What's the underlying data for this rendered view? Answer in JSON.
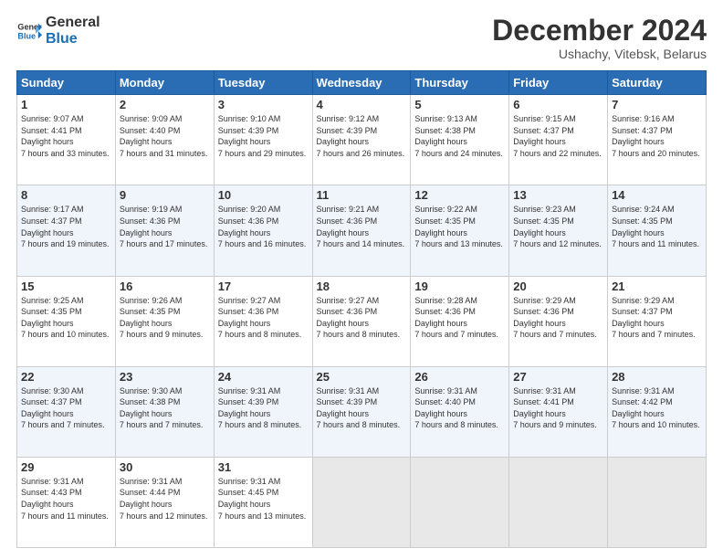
{
  "logo": {
    "line1": "General",
    "line2": "Blue"
  },
  "title": "December 2024",
  "subtitle": "Ushachy, Vitebsk, Belarus",
  "days_of_week": [
    "Sunday",
    "Monday",
    "Tuesday",
    "Wednesday",
    "Thursday",
    "Friday",
    "Saturday"
  ],
  "weeks": [
    [
      {
        "num": "1",
        "sunrise": "9:07 AM",
        "sunset": "4:41 PM",
        "daylight": "7 hours and 33 minutes."
      },
      {
        "num": "2",
        "sunrise": "9:09 AM",
        "sunset": "4:40 PM",
        "daylight": "7 hours and 31 minutes."
      },
      {
        "num": "3",
        "sunrise": "9:10 AM",
        "sunset": "4:39 PM",
        "daylight": "7 hours and 29 minutes."
      },
      {
        "num": "4",
        "sunrise": "9:12 AM",
        "sunset": "4:39 PM",
        "daylight": "7 hours and 26 minutes."
      },
      {
        "num": "5",
        "sunrise": "9:13 AM",
        "sunset": "4:38 PM",
        "daylight": "7 hours and 24 minutes."
      },
      {
        "num": "6",
        "sunrise": "9:15 AM",
        "sunset": "4:37 PM",
        "daylight": "7 hours and 22 minutes."
      },
      {
        "num": "7",
        "sunrise": "9:16 AM",
        "sunset": "4:37 PM",
        "daylight": "7 hours and 20 minutes."
      }
    ],
    [
      {
        "num": "8",
        "sunrise": "9:17 AM",
        "sunset": "4:37 PM",
        "daylight": "7 hours and 19 minutes."
      },
      {
        "num": "9",
        "sunrise": "9:19 AM",
        "sunset": "4:36 PM",
        "daylight": "7 hours and 17 minutes."
      },
      {
        "num": "10",
        "sunrise": "9:20 AM",
        "sunset": "4:36 PM",
        "daylight": "7 hours and 16 minutes."
      },
      {
        "num": "11",
        "sunrise": "9:21 AM",
        "sunset": "4:36 PM",
        "daylight": "7 hours and 14 minutes."
      },
      {
        "num": "12",
        "sunrise": "9:22 AM",
        "sunset": "4:35 PM",
        "daylight": "7 hours and 13 minutes."
      },
      {
        "num": "13",
        "sunrise": "9:23 AM",
        "sunset": "4:35 PM",
        "daylight": "7 hours and 12 minutes."
      },
      {
        "num": "14",
        "sunrise": "9:24 AM",
        "sunset": "4:35 PM",
        "daylight": "7 hours and 11 minutes."
      }
    ],
    [
      {
        "num": "15",
        "sunrise": "9:25 AM",
        "sunset": "4:35 PM",
        "daylight": "7 hours and 10 minutes."
      },
      {
        "num": "16",
        "sunrise": "9:26 AM",
        "sunset": "4:35 PM",
        "daylight": "7 hours and 9 minutes."
      },
      {
        "num": "17",
        "sunrise": "9:27 AM",
        "sunset": "4:36 PM",
        "daylight": "7 hours and 8 minutes."
      },
      {
        "num": "18",
        "sunrise": "9:27 AM",
        "sunset": "4:36 PM",
        "daylight": "7 hours and 8 minutes."
      },
      {
        "num": "19",
        "sunrise": "9:28 AM",
        "sunset": "4:36 PM",
        "daylight": "7 hours and 7 minutes."
      },
      {
        "num": "20",
        "sunrise": "9:29 AM",
        "sunset": "4:36 PM",
        "daylight": "7 hours and 7 minutes."
      },
      {
        "num": "21",
        "sunrise": "9:29 AM",
        "sunset": "4:37 PM",
        "daylight": "7 hours and 7 minutes."
      }
    ],
    [
      {
        "num": "22",
        "sunrise": "9:30 AM",
        "sunset": "4:37 PM",
        "daylight": "7 hours and 7 minutes."
      },
      {
        "num": "23",
        "sunrise": "9:30 AM",
        "sunset": "4:38 PM",
        "daylight": "7 hours and 7 minutes."
      },
      {
        "num": "24",
        "sunrise": "9:31 AM",
        "sunset": "4:39 PM",
        "daylight": "7 hours and 8 minutes."
      },
      {
        "num": "25",
        "sunrise": "9:31 AM",
        "sunset": "4:39 PM",
        "daylight": "7 hours and 8 minutes."
      },
      {
        "num": "26",
        "sunrise": "9:31 AM",
        "sunset": "4:40 PM",
        "daylight": "7 hours and 8 minutes."
      },
      {
        "num": "27",
        "sunrise": "9:31 AM",
        "sunset": "4:41 PM",
        "daylight": "7 hours and 9 minutes."
      },
      {
        "num": "28",
        "sunrise": "9:31 AM",
        "sunset": "4:42 PM",
        "daylight": "7 hours and 10 minutes."
      }
    ],
    [
      {
        "num": "29",
        "sunrise": "9:31 AM",
        "sunset": "4:43 PM",
        "daylight": "7 hours and 11 minutes."
      },
      {
        "num": "30",
        "sunrise": "9:31 AM",
        "sunset": "4:44 PM",
        "daylight": "7 hours and 12 minutes."
      },
      {
        "num": "31",
        "sunrise": "9:31 AM",
        "sunset": "4:45 PM",
        "daylight": "7 hours and 13 minutes."
      },
      null,
      null,
      null,
      null
    ]
  ]
}
